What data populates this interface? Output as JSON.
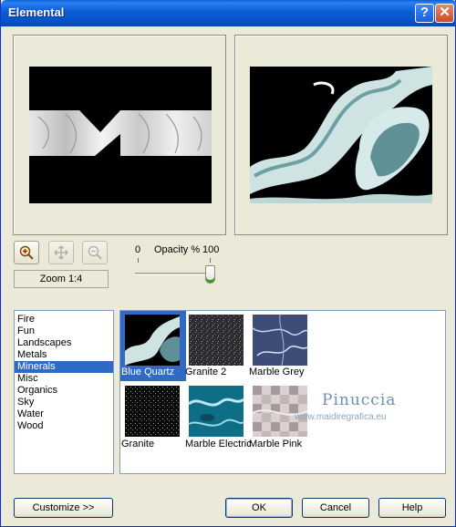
{
  "window": {
    "title": "Elemental",
    "help_glyph": "?",
    "close_glyph": "✕"
  },
  "tools": {
    "zoom_in_icon": "zoom-in-icon",
    "pan_icon": "move-arrows-icon",
    "zoom_out_icon": "zoom-out-icon"
  },
  "zoom": {
    "label": "Zoom 1:4"
  },
  "opacity": {
    "min_label": "0",
    "label": "Opacity %",
    "max_label": "100",
    "value": 100
  },
  "categories": {
    "items": [
      "Fire",
      "Fun",
      "Landscapes",
      "Metals",
      "Minerals",
      "Misc",
      "Organics",
      "Sky",
      "Water",
      "Wood"
    ],
    "selected": "Minerals"
  },
  "thumbnails": {
    "items": [
      "Blue Quartz",
      "Granite 2",
      "Marble Grey",
      "Granite",
      "Marble Electric",
      "Marble Pink"
    ],
    "selected": "Blue Quartz"
  },
  "watermark": {
    "text": "Pinuccia",
    "url": "www.maidiregrafica.eu"
  },
  "buttons": {
    "customize": "Customize   >>",
    "ok": "OK",
    "cancel": "Cancel",
    "help": "Help"
  },
  "colors": {
    "titlebar": "#0a5fd8",
    "selection": "#316ac5",
    "dialog_bg": "#ece9d8"
  }
}
